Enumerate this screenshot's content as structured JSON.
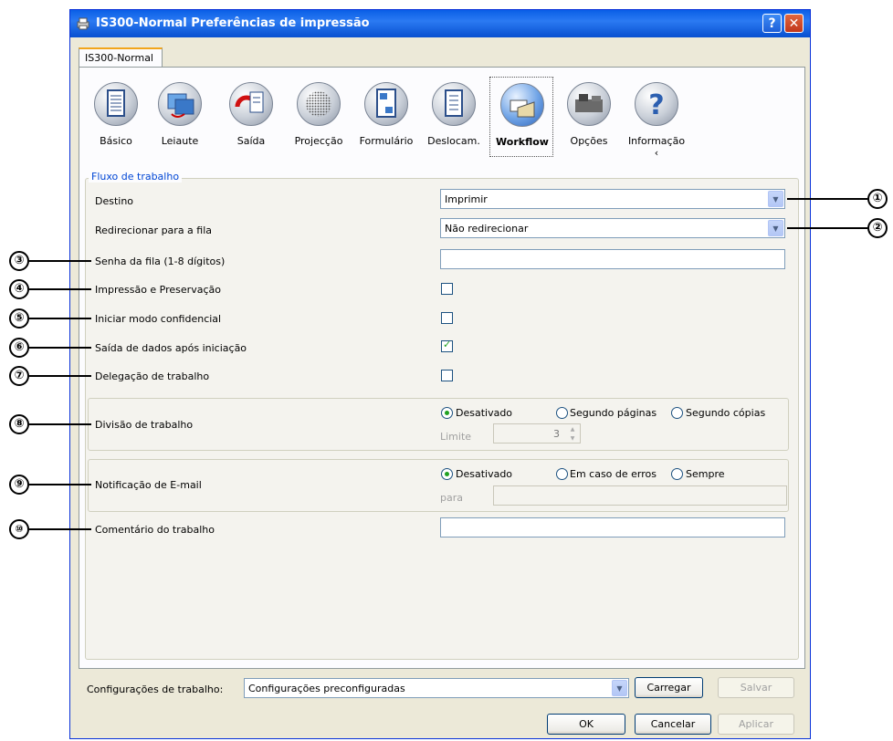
{
  "window": {
    "title": "IS300-Normal Preferências de impressão",
    "help_glyph": "?",
    "close_glyph": "✕"
  },
  "tab": {
    "label": "IS300-Normal"
  },
  "toolbar": {
    "items": [
      {
        "label": "Básico",
        "icon": "document-icon"
      },
      {
        "label": "Leiaute",
        "icon": "layout-icon"
      },
      {
        "label": "Saída",
        "icon": "output-icon"
      },
      {
        "label": "Projecção",
        "icon": "projection-icon"
      },
      {
        "label": "Formulário",
        "icon": "form-icon"
      },
      {
        "label": "Deslocam.",
        "icon": "shift-icon"
      },
      {
        "label": "Workflow",
        "icon": "workflow-icon",
        "selected": true
      },
      {
        "label": "Opções",
        "icon": "options-icon"
      },
      {
        "label": "Informação ‹",
        "icon": "help-icon"
      }
    ]
  },
  "workflow": {
    "group_title": "Fluxo de trabalho",
    "destination": {
      "label": "Destino",
      "value": "Imprimir"
    },
    "redirect": {
      "label": "Redirecionar para a fila",
      "value": "Não redirecionar"
    },
    "queue_password": {
      "label": "Senha da fila (1-8 dígitos)",
      "value": ""
    },
    "print_preserve": {
      "label": "Impressão e Preservação",
      "checked": false
    },
    "confidential": {
      "label": "Iniciar modo confidencial",
      "checked": false
    },
    "output_after_start": {
      "label": "Saída de dados após iniciação",
      "checked": true
    },
    "job_delegation": {
      "label": "Delegação de trabalho",
      "checked": false
    },
    "job_split": {
      "label": "Divisão de trabalho",
      "options": [
        "Desativado",
        "Segundo páginas",
        "Segundo cópias"
      ],
      "selected": "Desativado",
      "limit_label": "Limite",
      "limit_value": "3"
    },
    "email": {
      "label": "Notificação de E-mail",
      "options": [
        "Desativado",
        "Em caso de erros",
        "Sempre"
      ],
      "selected": "Desativado",
      "to_label": "para",
      "to_value": ""
    },
    "comment": {
      "label": "Comentário do trabalho",
      "value": ""
    }
  },
  "callouts": [
    "①",
    "②",
    "③",
    "④",
    "⑤",
    "⑥",
    "⑦",
    "⑧",
    "⑨",
    "⑩"
  ],
  "bottom": {
    "config_label": "Configurações de trabalho:",
    "config_value": "Configurações preconfiguradas",
    "load_label": "Carregar",
    "save_label": "Salvar",
    "ok_label": "OK",
    "cancel_label": "Cancelar",
    "apply_label": "Aplicar"
  },
  "colors": {
    "title_bar": "#0a5fe6",
    "group_title": "#0046d5",
    "check_mark": "#21a121"
  }
}
